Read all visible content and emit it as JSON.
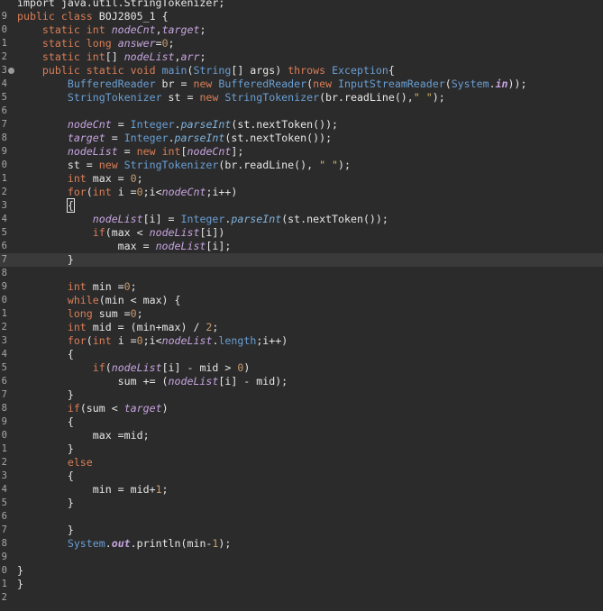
{
  "editor": {
    "lines": [
      {
        "n": "",
        "tokens": [
          {
            "t": "import java.util.StringTokenizer;",
            "c": "op"
          }
        ]
      },
      {
        "n": "9",
        "tokens": [
          {
            "t": "public ",
            "c": "kw"
          },
          {
            "t": "class ",
            "c": "kw"
          },
          {
            "t": "BOJ2805_1 {",
            "c": "op"
          }
        ]
      },
      {
        "n": "0",
        "tokens": [
          {
            "t": "    static ",
            "c": "kw"
          },
          {
            "t": "int ",
            "c": "kw"
          },
          {
            "t": "nodeCnt",
            "c": "fld"
          },
          {
            "t": ",",
            "c": "op"
          },
          {
            "t": "target",
            "c": "fld"
          },
          {
            "t": ";",
            "c": "op"
          }
        ]
      },
      {
        "n": "1",
        "tokens": [
          {
            "t": "    static ",
            "c": "kw"
          },
          {
            "t": "long ",
            "c": "kw"
          },
          {
            "t": "answer",
            "c": "fld"
          },
          {
            "t": "=",
            "c": "op"
          },
          {
            "t": "0",
            "c": "num"
          },
          {
            "t": ";",
            "c": "op"
          }
        ]
      },
      {
        "n": "2",
        "tokens": [
          {
            "t": "    static ",
            "c": "kw"
          },
          {
            "t": "int",
            "c": "kw"
          },
          {
            "t": "[] ",
            "c": "op"
          },
          {
            "t": "nodeList",
            "c": "fld"
          },
          {
            "t": ",",
            "c": "op"
          },
          {
            "t": "arr",
            "c": "fld"
          },
          {
            "t": ";",
            "c": "op"
          }
        ]
      },
      {
        "n": "3",
        "fold": true,
        "tokens": [
          {
            "t": "    public ",
            "c": "kw"
          },
          {
            "t": "static ",
            "c": "kw"
          },
          {
            "t": "void ",
            "c": "kw"
          },
          {
            "t": "main",
            "c": "ty"
          },
          {
            "t": "(",
            "c": "op"
          },
          {
            "t": "String",
            "c": "ty"
          },
          {
            "t": "[] args) ",
            "c": "op"
          },
          {
            "t": "throws ",
            "c": "kw"
          },
          {
            "t": "Exception",
            "c": "ty"
          },
          {
            "t": "{",
            "c": "op"
          }
        ]
      },
      {
        "n": "4",
        "tokens": [
          {
            "t": "        ",
            "c": "op"
          },
          {
            "t": "BufferedReader",
            "c": "ty"
          },
          {
            "t": " br = ",
            "c": "op"
          },
          {
            "t": "new ",
            "c": "kw"
          },
          {
            "t": "BufferedReader",
            "c": "ty"
          },
          {
            "t": "(",
            "c": "op"
          },
          {
            "t": "new ",
            "c": "kw"
          },
          {
            "t": "InputStreamReader",
            "c": "ty"
          },
          {
            "t": "(",
            "c": "op"
          },
          {
            "t": "System",
            "c": "ty"
          },
          {
            "t": ".",
            "c": "op"
          },
          {
            "t": "in",
            "c": "sf"
          },
          {
            "t": "));",
            "c": "op"
          }
        ]
      },
      {
        "n": "5",
        "tokens": [
          {
            "t": "        ",
            "c": "op"
          },
          {
            "t": "StringTokenizer",
            "c": "ty"
          },
          {
            "t": " st = ",
            "c": "op"
          },
          {
            "t": "new ",
            "c": "kw"
          },
          {
            "t": "StringTokenizer",
            "c": "ty"
          },
          {
            "t": "(br.readLine(),",
            "c": "op"
          },
          {
            "t": "\" \"",
            "c": "str"
          },
          {
            "t": ");",
            "c": "op"
          }
        ]
      },
      {
        "n": "6",
        "tokens": []
      },
      {
        "n": "7",
        "tokens": [
          {
            "t": "        ",
            "c": "op"
          },
          {
            "t": "nodeCnt",
            "c": "fld"
          },
          {
            "t": " = ",
            "c": "op"
          },
          {
            "t": "Integer",
            "c": "ty"
          },
          {
            "t": ".",
            "c": "op"
          },
          {
            "t": "parseInt",
            "c": "sm"
          },
          {
            "t": "(st.nextToken());",
            "c": "op"
          }
        ]
      },
      {
        "n": "8",
        "tokens": [
          {
            "t": "        ",
            "c": "op"
          },
          {
            "t": "target",
            "c": "fld"
          },
          {
            "t": " = ",
            "c": "op"
          },
          {
            "t": "Integer",
            "c": "ty"
          },
          {
            "t": ".",
            "c": "op"
          },
          {
            "t": "parseInt",
            "c": "sm"
          },
          {
            "t": "(st.nextToken());",
            "c": "op"
          }
        ]
      },
      {
        "n": "9",
        "tokens": [
          {
            "t": "        ",
            "c": "op"
          },
          {
            "t": "nodeList",
            "c": "fld"
          },
          {
            "t": " = ",
            "c": "op"
          },
          {
            "t": "new ",
            "c": "kw"
          },
          {
            "t": "int",
            "c": "kw"
          },
          {
            "t": "[",
            "c": "op"
          },
          {
            "t": "nodeCnt",
            "c": "fld"
          },
          {
            "t": "];",
            "c": "op"
          }
        ]
      },
      {
        "n": "0",
        "tokens": [
          {
            "t": "        st = ",
            "c": "op"
          },
          {
            "t": "new ",
            "c": "kw"
          },
          {
            "t": "StringTokenizer",
            "c": "ty"
          },
          {
            "t": "(br.readLine(), ",
            "c": "op"
          },
          {
            "t": "\" \"",
            "c": "str"
          },
          {
            "t": ");",
            "c": "op"
          }
        ]
      },
      {
        "n": "1",
        "tokens": [
          {
            "t": "        ",
            "c": "op"
          },
          {
            "t": "int ",
            "c": "kw"
          },
          {
            "t": "max = ",
            "c": "op"
          },
          {
            "t": "0",
            "c": "num"
          },
          {
            "t": ";",
            "c": "op"
          }
        ]
      },
      {
        "n": "2",
        "tokens": [
          {
            "t": "        ",
            "c": "op"
          },
          {
            "t": "for",
            "c": "kw"
          },
          {
            "t": "(",
            "c": "op"
          },
          {
            "t": "int ",
            "c": "kw"
          },
          {
            "t": "i =",
            "c": "op"
          },
          {
            "t": "0",
            "c": "num"
          },
          {
            "t": ";i<",
            "c": "op"
          },
          {
            "t": "nodeCnt",
            "c": "fld"
          },
          {
            "t": ";i++)",
            "c": "op"
          }
        ]
      },
      {
        "n": "3",
        "tokens": [
          {
            "t": "        ",
            "c": "op"
          },
          {
            "t": "{",
            "c": "op",
            "box": true
          }
        ]
      },
      {
        "n": "4",
        "tokens": [
          {
            "t": "            ",
            "c": "op"
          },
          {
            "t": "nodeList",
            "c": "fld"
          },
          {
            "t": "[i] = ",
            "c": "op"
          },
          {
            "t": "Integer",
            "c": "ty"
          },
          {
            "t": ".",
            "c": "op"
          },
          {
            "t": "parseInt",
            "c": "sm"
          },
          {
            "t": "(st.nextToken());",
            "c": "op"
          }
        ]
      },
      {
        "n": "5",
        "tokens": [
          {
            "t": "            ",
            "c": "op"
          },
          {
            "t": "if",
            "c": "kw"
          },
          {
            "t": "(max < ",
            "c": "op"
          },
          {
            "t": "nodeList",
            "c": "fld"
          },
          {
            "t": "[i])",
            "c": "op"
          }
        ]
      },
      {
        "n": "6",
        "tokens": [
          {
            "t": "                max = ",
            "c": "op"
          },
          {
            "t": "nodeList",
            "c": "fld"
          },
          {
            "t": "[i];",
            "c": "op"
          }
        ]
      },
      {
        "n": "7",
        "current": true,
        "tokens": [
          {
            "t": "        }",
            "c": "op"
          }
        ]
      },
      {
        "n": "8",
        "tokens": []
      },
      {
        "n": "9",
        "tokens": [
          {
            "t": "        ",
            "c": "op"
          },
          {
            "t": "int ",
            "c": "kw"
          },
          {
            "t": "min =",
            "c": "op"
          },
          {
            "t": "0",
            "c": "num"
          },
          {
            "t": ";",
            "c": "op"
          }
        ]
      },
      {
        "n": "0",
        "tokens": [
          {
            "t": "        ",
            "c": "op"
          },
          {
            "t": "while",
            "c": "kw"
          },
          {
            "t": "(min < max) {",
            "c": "op"
          }
        ]
      },
      {
        "n": "1",
        "tokens": [
          {
            "t": "        ",
            "c": "op"
          },
          {
            "t": "long ",
            "c": "kw"
          },
          {
            "t": "sum =",
            "c": "op"
          },
          {
            "t": "0",
            "c": "num"
          },
          {
            "t": ";",
            "c": "op"
          }
        ]
      },
      {
        "n": "2",
        "tokens": [
          {
            "t": "        ",
            "c": "op"
          },
          {
            "t": "int ",
            "c": "kw"
          },
          {
            "t": "mid = (min+max) / ",
            "c": "op"
          },
          {
            "t": "2",
            "c": "num"
          },
          {
            "t": ";",
            "c": "op"
          }
        ]
      },
      {
        "n": "3",
        "tokens": [
          {
            "t": "        ",
            "c": "op"
          },
          {
            "t": "for",
            "c": "kw"
          },
          {
            "t": "(",
            "c": "op"
          },
          {
            "t": "int ",
            "c": "kw"
          },
          {
            "t": "i =",
            "c": "op"
          },
          {
            "t": "0",
            "c": "num"
          },
          {
            "t": ";i<",
            "c": "op"
          },
          {
            "t": "nodeList",
            "c": "fld"
          },
          {
            "t": ".",
            "c": "op"
          },
          {
            "t": "length",
            "c": "ty"
          },
          {
            "t": ";i++)",
            "c": "op"
          }
        ]
      },
      {
        "n": "4",
        "tokens": [
          {
            "t": "        {",
            "c": "op"
          }
        ]
      },
      {
        "n": "5",
        "tokens": [
          {
            "t": "            ",
            "c": "op"
          },
          {
            "t": "if",
            "c": "kw"
          },
          {
            "t": "(",
            "c": "op"
          },
          {
            "t": "nodeList",
            "c": "fld"
          },
          {
            "t": "[i] - mid > ",
            "c": "op"
          },
          {
            "t": "0",
            "c": "num"
          },
          {
            "t": ")",
            "c": "op"
          }
        ]
      },
      {
        "n": "6",
        "tokens": [
          {
            "t": "                sum += (",
            "c": "op"
          },
          {
            "t": "nodeList",
            "c": "fld"
          },
          {
            "t": "[i] - mid);",
            "c": "op"
          }
        ]
      },
      {
        "n": "7",
        "tokens": [
          {
            "t": "        }",
            "c": "op"
          }
        ]
      },
      {
        "n": "8",
        "tokens": [
          {
            "t": "        ",
            "c": "op"
          },
          {
            "t": "if",
            "c": "kw"
          },
          {
            "t": "(sum < ",
            "c": "op"
          },
          {
            "t": "target",
            "c": "fld"
          },
          {
            "t": ")",
            "c": "op"
          }
        ]
      },
      {
        "n": "9",
        "tokens": [
          {
            "t": "        {",
            "c": "op"
          }
        ]
      },
      {
        "n": "0",
        "tokens": [
          {
            "t": "            max =mid;",
            "c": "op"
          }
        ]
      },
      {
        "n": "1",
        "tokens": [
          {
            "t": "        }",
            "c": "op"
          }
        ]
      },
      {
        "n": "2",
        "tokens": [
          {
            "t": "        ",
            "c": "op"
          },
          {
            "t": "else",
            "c": "kw"
          }
        ]
      },
      {
        "n": "3",
        "tokens": [
          {
            "t": "        {",
            "c": "op"
          }
        ]
      },
      {
        "n": "4",
        "tokens": [
          {
            "t": "            min = mid+",
            "c": "op"
          },
          {
            "t": "1",
            "c": "num"
          },
          {
            "t": ";",
            "c": "op"
          }
        ]
      },
      {
        "n": "5",
        "tokens": [
          {
            "t": "        }",
            "c": "op"
          }
        ]
      },
      {
        "n": "6",
        "tokens": []
      },
      {
        "n": "7",
        "tokens": [
          {
            "t": "        }",
            "c": "op"
          }
        ]
      },
      {
        "n": "8",
        "tokens": [
          {
            "t": "        ",
            "c": "op"
          },
          {
            "t": "System",
            "c": "ty"
          },
          {
            "t": ".",
            "c": "op"
          },
          {
            "t": "out",
            "c": "sf"
          },
          {
            "t": ".println(min-",
            "c": "op"
          },
          {
            "t": "1",
            "c": "num"
          },
          {
            "t": ");",
            "c": "op"
          }
        ]
      },
      {
        "n": "9",
        "tokens": []
      },
      {
        "n": "0",
        "tokens": [
          {
            "t": "}",
            "c": "op"
          }
        ]
      },
      {
        "n": "1",
        "tokens": [
          {
            "t": "}",
            "c": "op"
          }
        ]
      },
      {
        "n": "2",
        "tokens": []
      }
    ]
  }
}
